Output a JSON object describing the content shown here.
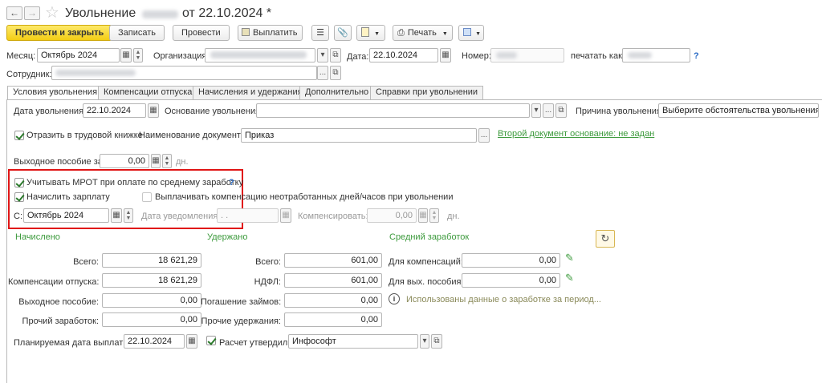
{
  "window": {
    "title_prefix": "Увольнение",
    "title_suffix": "от 22.10.2024 *"
  },
  "toolbar": {
    "post_close": "Провести и закрыть",
    "save": "Записать",
    "post": "Провести",
    "pay": "Выплатить",
    "print": "Печать"
  },
  "header": {
    "month_label": "Месяц:",
    "month_value": "Октябрь 2024",
    "org_label": "Организация:",
    "date_label": "Дата:",
    "date_value": "22.10.2024",
    "number_label": "Номер:",
    "print_as_label": "печатать как:",
    "help": "?",
    "employee_label": "Сотрудник:"
  },
  "tabs": [
    {
      "label": "Условия увольнения"
    },
    {
      "label": "Компенсации отпуска"
    },
    {
      "label": "Начисления и удержания"
    },
    {
      "label": "Дополнительно"
    },
    {
      "label": "Справки при увольнении"
    }
  ],
  "conditions": {
    "dismissal_date_label": "Дата увольнения:",
    "dismissal_date_value": "22.10.2024",
    "basis_label": "Основание увольнения:",
    "reason_label": "Причина увольнения:",
    "reason_value": "Выберите обстоятельства увольнения...",
    "workbook_label": "Отразить в трудовой книжке",
    "doc_name_label": "Наименование документа:",
    "doc_name_value": "Приказ",
    "second_doc_link": "Второй документ основание: не задан",
    "severance_label": "Выходное пособие за:",
    "severance_value": "0,00",
    "days_unit": "дн.",
    "mrot_label": "Учитывать МРОТ при оплате по среднему заработку",
    "mrot_help": "?",
    "accrue_label": "Начислить зарплату",
    "pay_comp_label": "Выплачивать компенсацию неотработанных дней/часов при увольнении",
    "from_label": "С:",
    "from_value": "Октябрь 2024",
    "notice_date_label": "Дата уведомления:",
    "notice_date_value": ". .",
    "compensate_label": "Компенсировать:",
    "compensate_value": "0,00",
    "days_unit2": "дн."
  },
  "sections": {
    "accrued": "Начислено",
    "withheld": "Удержано",
    "avg_earnings": "Средний заработок"
  },
  "accrued": [
    {
      "label": "Всего:",
      "value": "18 621,29"
    },
    {
      "label": "Компенсации отпуска:",
      "value": "18 621,29"
    },
    {
      "label": "Выходное пособие:",
      "value": "0,00"
    },
    {
      "label": "Прочий заработок:",
      "value": "0,00"
    }
  ],
  "withheld": [
    {
      "label": "Всего:",
      "value": "601,00"
    },
    {
      "label": "НДФЛ:",
      "value": "601,00"
    },
    {
      "label": "Погашение займов:",
      "value": "0,00"
    },
    {
      "label": "Прочие удержания:",
      "value": "0,00"
    }
  ],
  "avg": {
    "comp_label": "Для компенсаций:",
    "comp_value": "0,00",
    "sev_label": "Для вых. пособия:",
    "sev_value": "0,00",
    "info_text": "Использованы данные о заработке за период..."
  },
  "footer": {
    "pay_date_label": "Планируемая дата выплаты:",
    "pay_date_value": "22.10.2024",
    "approved_label": "Расчет утвердил",
    "approved_value": "Инфософт"
  },
  "colors": {
    "primary_button": "#f3cd14",
    "highlight_border": "#e01515",
    "green_text": "#3c9a3c"
  }
}
